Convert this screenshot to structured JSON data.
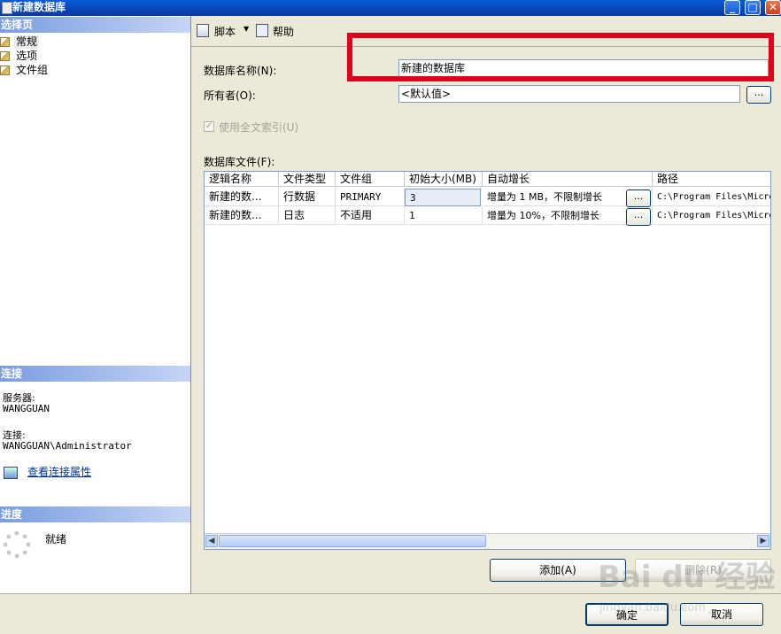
{
  "window": {
    "title": "新建数据库"
  },
  "left_pane": {
    "select_page_header": "选择页",
    "pages": [
      {
        "label": "常规",
        "selected": true
      },
      {
        "label": "选项",
        "selected": false
      },
      {
        "label": "文件组",
        "selected": false
      }
    ],
    "connection_header": "连接",
    "server_label": "服务器:",
    "server_value": "WANGGUAN",
    "connection_label": "连接:",
    "connection_value": "WANGGUAN\\Administrator",
    "view_connection_link": "查看连接属性",
    "progress_header": "进度",
    "progress_status": "就绪"
  },
  "toolbar": {
    "script_label": "脚本",
    "help_label": "帮助"
  },
  "form": {
    "db_name_label": "数据库名称(N):",
    "db_name_value": "新建的数据库",
    "owner_label": "所有者(O):",
    "owner_value": "<默认值>",
    "browse_label": "...",
    "fulltext_label": "使用全文索引(U)",
    "fulltext_checked": true,
    "files_label": "数据库文件(F):"
  },
  "grid": {
    "columns": [
      "逻辑名称",
      "文件类型",
      "文件组",
      "初始大小(MB)",
      "自动增长",
      "路径"
    ],
    "rows": [
      [
        "新建的数...",
        "行数据",
        "PRIMARY",
        "3",
        "增量为 1 MB，不限制增长",
        "C:\\Program Files\\Micro"
      ],
      [
        "新建的数...",
        "日志",
        "不适用",
        "1",
        "增量为 10%，不限制增长",
        "C:\\Program Files\\Micro"
      ]
    ],
    "cell_button": "..."
  },
  "buttons": {
    "add": "添加(A)",
    "remove": "删除(R)",
    "ok": "确定",
    "cancel": "取消"
  },
  "watermark": {
    "text": "Bai du 经验",
    "url": "jingyan.baidu.com"
  },
  "colors": {
    "title_bar": "#0a4fc8",
    "section_header": "#7a9de0",
    "highlight": "#e0001b",
    "link": "#003399"
  }
}
